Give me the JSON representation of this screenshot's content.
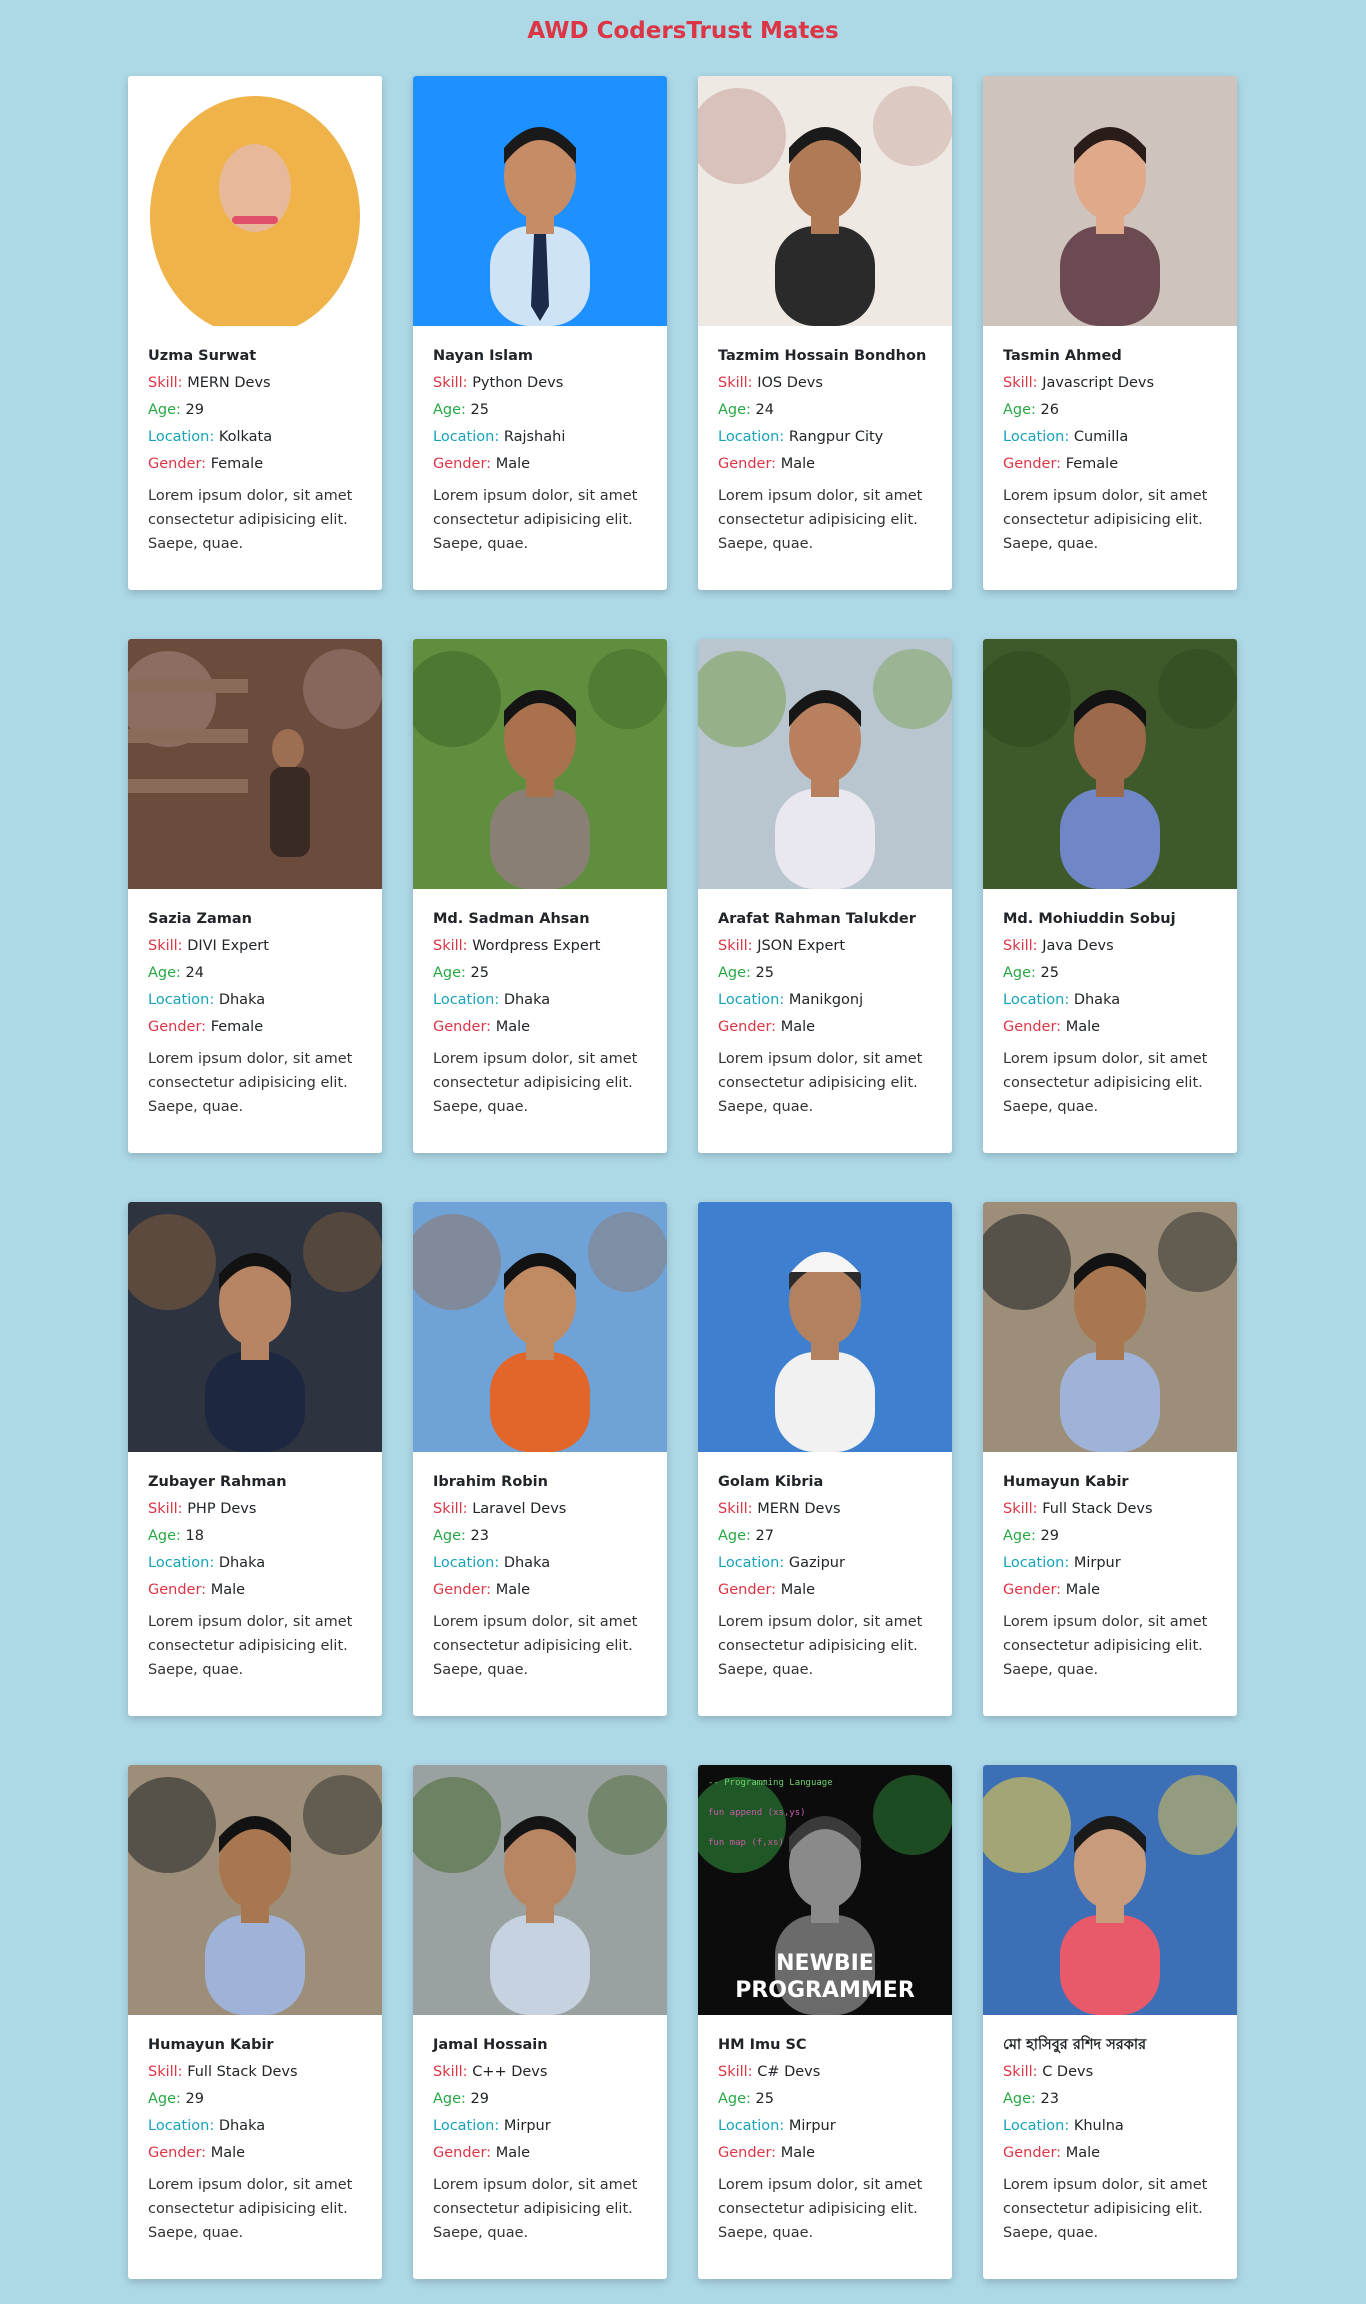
{
  "header": {
    "title": "AWD CodersTrust Mates"
  },
  "labels": {
    "skill": "Skill:",
    "age": "Age:",
    "location": "Location:",
    "gender": "Gender:"
  },
  "colors": {
    "background": "#add8e6",
    "title": "#dc3545",
    "skill_label": "#dc3545",
    "age_label": "#28a745",
    "location_label": "#17a2b8",
    "gender_label": "#dc3545"
  },
  "cards": [
    {
      "name": "Uzma Surwat",
      "skill": "MERN Devs",
      "age": "29",
      "location": "Kolkata",
      "gender": "Female",
      "description": "Lorem ipsum dolor, sit amet consectetur adipisicing elit. Saepe, quae.",
      "photo": "woman-yellow-hijab"
    },
    {
      "name": "Nayan Islam",
      "skill": "Python Devs",
      "age": "25",
      "location": "Rajshahi",
      "gender": "Male",
      "description": "Lorem ipsum dolor, sit amet consectetur adipisicing elit. Saepe, quae.",
      "photo": "man-blue-background-tie"
    },
    {
      "name": "Tazmim Hossain Bondhon",
      "skill": "IOS Devs",
      "age": "24",
      "location": "Rangpur City",
      "gender": "Male",
      "description": "Lorem ipsum dolor, sit amet consectetur adipisicing elit. Saepe, quae.",
      "photo": "man-sketch-background"
    },
    {
      "name": "Tasmin Ahmed",
      "skill": "Javascript Devs",
      "age": "26",
      "location": "Cumilla",
      "gender": "Female",
      "description": "Lorem ipsum dolor, sit amet consectetur adipisicing elit. Saepe, quae.",
      "photo": "woman-smiling"
    },
    {
      "name": "Sazia Zaman",
      "skill": "DIVI Expert",
      "age": "24",
      "location": "Dhaka",
      "gender": "Female",
      "description": "Lorem ipsum dolor, sit amet consectetur adipisicing elit. Saepe, quae.",
      "photo": "bookstore-shelves"
    },
    {
      "name": "Md. Sadman Ahsan",
      "skill": "Wordpress Expert",
      "age": "25",
      "location": "Dhaka",
      "gender": "Male",
      "description": "Lorem ipsum dolor, sit amet consectetur adipisicing elit. Saepe, quae.",
      "photo": "man-sitting-park"
    },
    {
      "name": "Arafat Rahman Talukder",
      "skill": "JSON Expert",
      "age": "25",
      "location": "Manikgonj",
      "gender": "Male",
      "description": "Lorem ipsum dolor, sit amet consectetur adipisicing elit. Saepe, quae.",
      "photo": "man-street"
    },
    {
      "name": "Md. Mohiuddin Sobuj",
      "skill": "Java Devs",
      "age": "25",
      "location": "Dhaka",
      "gender": "Male",
      "description": "Lorem ipsum dolor, sit amet consectetur adipisicing elit. Saepe, quae.",
      "photo": "man-garden"
    },
    {
      "name": "Zubayer Rahman",
      "skill": "PHP Devs",
      "age": "18",
      "location": "Dhaka",
      "gender": "Male",
      "description": "Lorem ipsum dolor, sit amet consectetur adipisicing elit. Saepe, quae.",
      "photo": "man-suit-indoor"
    },
    {
      "name": "Ibrahim Robin",
      "skill": "Laravel Devs",
      "age": "23",
      "location": "Dhaka",
      "gender": "Male",
      "description": "Lorem ipsum dolor, sit amet consectetur adipisicing elit. Saepe, quae.",
      "photo": "man-orange-jacket"
    },
    {
      "name": "Golam Kibria",
      "skill": "MERN Devs",
      "age": "27",
      "location": "Gazipur",
      "gender": "Male",
      "description": "Lorem ipsum dolor, sit amet consectetur adipisicing elit. Saepe, quae.",
      "photo": "man-white-cap"
    },
    {
      "name": "Humayun Kabir",
      "skill": "Full Stack Devs",
      "age": "29",
      "location": "Mirpur",
      "gender": "Male",
      "description": "Lorem ipsum dolor, sit amet consectetur adipisicing elit. Saepe, quae.",
      "photo": "man-office-chair"
    },
    {
      "name": "Humayun Kabir",
      "skill": "Full Stack Devs",
      "age": "29",
      "location": "Dhaka",
      "gender": "Male",
      "description": "Lorem ipsum dolor, sit amet consectetur adipisicing elit. Saepe, quae.",
      "photo": "man-office-chair"
    },
    {
      "name": "Jamal Hossain",
      "skill": "C++ Devs",
      "age": "29",
      "location": "Mirpur",
      "gender": "Male",
      "description": "Lorem ipsum dolor, sit amet consectetur adipisicing elit. Saepe, quae.",
      "photo": "man-hillside"
    },
    {
      "name": "HM Imu SC",
      "skill": "C# Devs",
      "age": "25",
      "location": "Mirpur",
      "gender": "Male",
      "description": "Lorem ipsum dolor, sit amet consectetur adipisicing elit. Saepe, quae.",
      "photo": "newbie-programmer-art",
      "photo_text": [
        "NEWBIE",
        "PROGRAMMER"
      ]
    },
    {
      "name": "মো হাসিবুর রশিদ সরকার",
      "skill": "C Devs",
      "age": "23",
      "location": "Khulna",
      "gender": "Male",
      "description": "Lorem ipsum dolor, sit amet consectetur adipisicing elit. Saepe, quae.",
      "photo": "man-graffiti-wall"
    }
  ]
}
